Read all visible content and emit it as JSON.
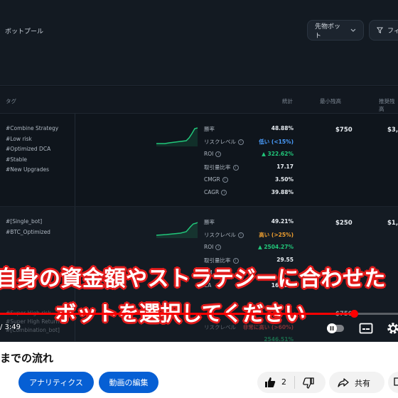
{
  "app": {
    "page_title": "ボットプール",
    "bot_filter_label": "先物ボット",
    "filter_label": "フィ"
  },
  "table": {
    "headers": {
      "tag": "タグ",
      "stats": "統計",
      "min_balance": "最小残高",
      "recommended": "推奨残高"
    },
    "rows": [
      {
        "tags": [
          "#Combine Strategy",
          "#Low risk",
          "#Optimized DCA",
          "#Stable",
          "#New Upgrades"
        ],
        "stats": [
          {
            "key": "勝率",
            "value": "48.88%",
            "info": false,
            "color": "#e8edf2"
          },
          {
            "key": "リスクレベル",
            "value": "低い (<15%)",
            "info": true,
            "color": "#4a9eff"
          },
          {
            "key": "ROI",
            "value": "▲ 322.62%",
            "info": true,
            "color": "#21c77a"
          },
          {
            "key": "取引量比率",
            "value": "17.17",
            "info": true,
            "color": "#e8edf2"
          },
          {
            "key": "CMGR",
            "value": "3.50%",
            "info": true,
            "color": "#e8edf2"
          },
          {
            "key": "CAGR",
            "value": "39.88%",
            "info": true,
            "color": "#e8edf2"
          }
        ],
        "min_balance": "$750",
        "recommended": "$3,"
      },
      {
        "tags": [
          "#[Single_bot]",
          "#BTC_Optimized"
        ],
        "stats": [
          {
            "key": "勝率",
            "value": "49.21%",
            "info": false,
            "color": "#e8edf2"
          },
          {
            "key": "リスクレベル",
            "value": "高い (>25%)",
            "info": true,
            "color": "#f0a030"
          },
          {
            "key": "ROI",
            "value": "▲ 2504.27%",
            "info": true,
            "color": "#21c77a"
          },
          {
            "key": "取引量比率",
            "value": "29.55",
            "info": true,
            "color": "#e8edf2"
          },
          {
            "key": "CM",
            "value": "25%",
            "info": false,
            "color": "#e8edf2"
          },
          {
            "key": "CA",
            "value": "16.62%",
            "info": false,
            "color": "#e8edf2"
          }
        ],
        "min_balance": "$250",
        "recommended": "$1,"
      }
    ],
    "row3": {
      "tags": [
        "#Super High risk",
        "#Super High Return",
        "#[Combination_bot]"
      ],
      "risk_key": "リスクレベル",
      "risk_value": "非常に高い (>60%)",
      "roi_value": "2546.51%",
      "min_balance": "$750"
    }
  },
  "subtitles": {
    "line1": "自身の資金額やストラテジーに合わせた",
    "line2": "ボットを選択してください"
  },
  "player": {
    "time": "/ 3:49",
    "progress": 0.89
  },
  "video": {
    "title": "までの流れ",
    "analytics_label": "アナリティクス",
    "edit_label": "動画の編集",
    "like_count": "2",
    "share_label": "共有"
  },
  "colors": {
    "accent": "#065fd4",
    "subtitle_outline": "#e11b1b",
    "progress": "#ff0000"
  }
}
